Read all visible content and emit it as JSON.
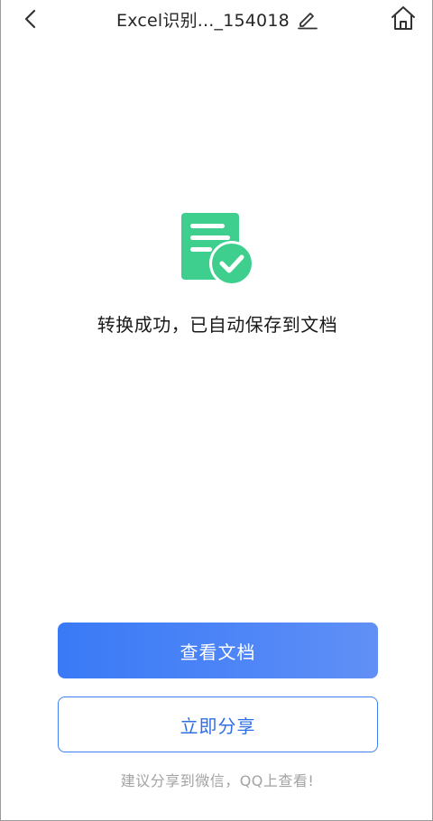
{
  "header": {
    "title": "Excel识别..._154018",
    "back_icon": "chevron-left-icon",
    "edit_icon": "pencil-icon",
    "home_icon": "home-icon"
  },
  "result": {
    "icon": "document-check-icon",
    "message": "转换成功，已自动保存到文档"
  },
  "actions": {
    "view_label": "查看文档",
    "share_label": "立即分享",
    "hint": "建议分享到微信，QQ上查看!"
  },
  "colors": {
    "primary": "#3a7af6",
    "success": "#3ecf8e",
    "hint": "#a3a3a3"
  }
}
